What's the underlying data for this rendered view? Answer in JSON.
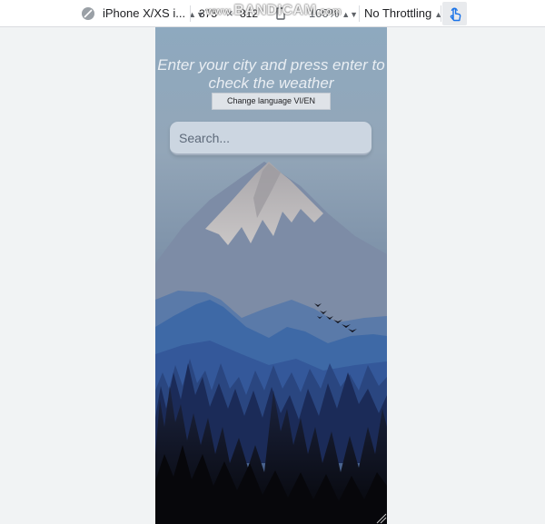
{
  "devtools_toolbar": {
    "device_select": "iPhone X/XS i...",
    "width_value": "375",
    "dimension_separator": "×",
    "height_value": "812",
    "zoom_select": "100%",
    "throttling_select": "No Throttling"
  },
  "watermark": {
    "brand": "BANDICAM",
    "suffix": ".com",
    "prefix": "www."
  },
  "app": {
    "headline": "Enter your city and press enter to check the weather",
    "language_button": "Change language VI/EN",
    "search_placeholder": "Search..."
  },
  "icons": {
    "device": "no-entry-compass-icon",
    "rotate": "rotate-icon",
    "touch": "touch-hand-icon"
  },
  "colors": {
    "sky_top": "#8fa9bf",
    "mountain_peak": "#b7b4b6",
    "ridge_blue": "#3f6aa6",
    "forest_dark": "#0d1020",
    "toolbar_bg": "#ffffff",
    "page_bg": "#f1f3f4"
  }
}
